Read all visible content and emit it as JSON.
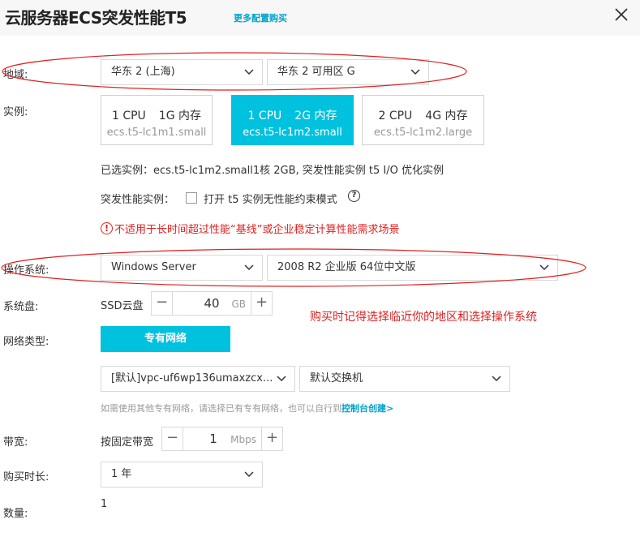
{
  "dialog": {
    "title": "云服务器ECS突发性能T5",
    "more_link": "更多配置购买"
  },
  "region": {
    "label": "地域:",
    "region_value": "华东 2 (上海)",
    "zone_value": "华东 2 可用区 G"
  },
  "instance": {
    "label": "实例:",
    "options": [
      {
        "cpu": "1 CPU",
        "mem": "1G 内存",
        "spec": "ecs.t5-lc1m1.small",
        "selected": false
      },
      {
        "cpu": "1 CPU",
        "mem": "2G 内存",
        "spec": "ecs.t5-lc1m2.small",
        "selected": true
      },
      {
        "cpu": "2 CPU",
        "mem": "4G 内存",
        "spec": "ecs.t5-lc1m2.large",
        "selected": false
      }
    ],
    "selected_info": "已选实例：ecs.t5-lc1m2.small1核 2GB, 突发性能实例 t5 I/O 优化实例",
    "burst_label": "突发性能实例：",
    "burst_checkbox_label": "打开 t5 实例无性能约束模式",
    "burst_checked": false,
    "warning": "不适用于长时间超过性能“基线”或企业稳定计算性能需求场景"
  },
  "os": {
    "label": "操作系统:",
    "type_value": "Windows Server",
    "version_value": "2008 R2 企业版 64位中文版"
  },
  "disk": {
    "label": "系统盘:",
    "type": "SSD云盘",
    "size": "40",
    "unit": "GB"
  },
  "annotation_note": "购买时记得选择临近你的地区和选择操作系统",
  "network": {
    "label": "网络类型:",
    "type_button": "专有网络",
    "vpc_value": "[默认]vpc-uf6wp136umaxzcx...",
    "switch_value": "默认交换机",
    "hint_text": "如需使用其他专有网络，请选择已有专有网络，也可以自行到",
    "hint_link": "控制台创建>"
  },
  "bandwidth": {
    "label": "带宽:",
    "type": "按固定带宽",
    "value": "1",
    "unit": "Mbps"
  },
  "duration": {
    "label": "购买时长:",
    "value": "1 年"
  },
  "quantity": {
    "label": "数量:",
    "value": "1"
  },
  "colors": {
    "accent": "#00c1de",
    "link": "#00a2ca",
    "warning": "#e02020"
  }
}
